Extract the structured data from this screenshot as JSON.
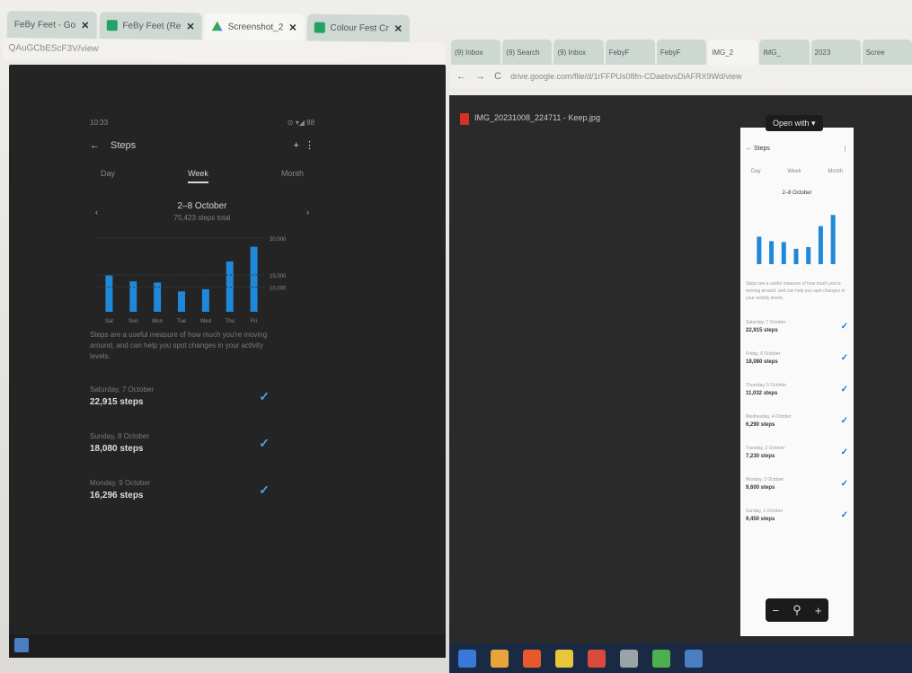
{
  "left": {
    "tabs": [
      {
        "label": "FeBy Feet - Go",
        "icon": "sheet-icon",
        "active": false
      },
      {
        "label": "FeBy Feet (Re",
        "icon": "sheet-icon",
        "active": false
      },
      {
        "label": "Screenshot_2",
        "icon": "drive-icon",
        "active": true
      },
      {
        "label": "Colour Fest Cr",
        "icon": "sheet-icon",
        "active": false
      }
    ],
    "url": "QAuGCbEScF3V/view",
    "phone": {
      "time": "10:33",
      "status_right": "⊙ ▾◢ 88",
      "screen_title": "Steps",
      "segments": [
        "Day",
        "Week",
        "Month"
      ],
      "active_segment": "Week",
      "range_title": "2–8 October",
      "range_sub": "75,423 steps total",
      "description": "Steps are a useful measure of how much you're moving around, and can help you spot changes in your activity levels.",
      "days": [
        {
          "label": "Saturday, 7 October",
          "value": "22,915 steps"
        },
        {
          "label": "Sunday, 8 October",
          "value": "18,080 steps"
        },
        {
          "label": "Monday, 9 October",
          "value": "16,296 steps"
        }
      ]
    }
  },
  "right": {
    "tabs": [
      "(9) Inbox",
      "(9) Search",
      "(9) Inbox",
      "FebyF",
      "FebyF",
      "IMG_2",
      "IMG_",
      "2023",
      "Scree"
    ],
    "active_tab_index": 5,
    "address": "drive.google.com/file/d/1rFFPUs08fn-CDaebvsDiAFRX9Wd/view",
    "file_name": "IMG_20231008_224711 - Keep.jpg",
    "open_with": "Open with ▾",
    "phone": {
      "title": "Steps",
      "segments": [
        "Day",
        "Week",
        "Month"
      ],
      "range": "2–8 October",
      "rows": [
        {
          "label": "Saturday, 7 October",
          "value": "22,915 steps"
        },
        {
          "label": "Friday, 6 October",
          "value": "18,080 steps"
        },
        {
          "label": "Thursday, 5 October",
          "value": "11,032 steps"
        },
        {
          "label": "Wednesday, 4 October",
          "value": "6,290 steps"
        },
        {
          "label": "Tuesday, 3 October",
          "value": "7,230 steps"
        },
        {
          "label": "Monday, 2 October",
          "value": "9,600 steps"
        },
        {
          "label": "Sunday, 1 October",
          "value": "9,450 steps"
        }
      ]
    }
  },
  "chart_data": {
    "type": "bar",
    "categories": [
      "Sat",
      "Sun",
      "Mon",
      "Tue",
      "Wed",
      "Thu",
      "Fri"
    ],
    "values": [
      14800,
      12400,
      11900,
      8300,
      9200,
      20500,
      26500
    ],
    "ylim": [
      0,
      30000
    ],
    "yticks": [
      "30,000",
      "15,000",
      "10,000"
    ],
    "color": "#1f88d8"
  }
}
